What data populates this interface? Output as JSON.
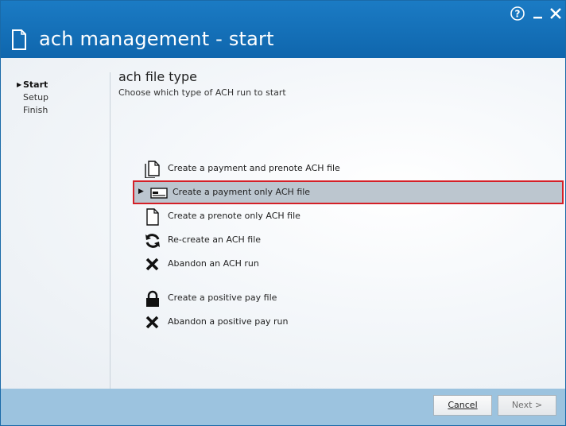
{
  "window": {
    "title": "ach management - start",
    "controls": {
      "help_icon": "help-circle-icon",
      "minimize_icon": "minimize-icon",
      "close_icon": "close-icon"
    }
  },
  "sidebar": {
    "items": [
      {
        "label": "Start",
        "active": true
      },
      {
        "label": "Setup",
        "active": false
      },
      {
        "label": "Finish",
        "active": false
      }
    ]
  },
  "main": {
    "heading": "ach file type",
    "subheading": "Choose which type of ACH run to start",
    "options": [
      {
        "label": "Create a payment and prenote ACH file",
        "icon": "documents-icon",
        "selected": false
      },
      {
        "label": "Create a payment only ACH file",
        "icon": "check-payment-icon",
        "selected": true
      },
      {
        "label": "Create a prenote only ACH file",
        "icon": "document-icon",
        "selected": false
      },
      {
        "label": "Re-create an ACH file",
        "icon": "refresh-icon",
        "selected": false
      },
      {
        "label": "Abandon an ACH run",
        "icon": "x-icon",
        "selected": false
      },
      {
        "label": "Create a positive pay file",
        "icon": "lock-icon",
        "selected": false
      },
      {
        "label": "Abandon a positive pay run",
        "icon": "x-icon",
        "selected": false
      }
    ]
  },
  "footer": {
    "cancel_label": "Cancel",
    "next_label": "Next >"
  },
  "colors": {
    "titlebar": "#1570b8",
    "footer": "#9cc3df",
    "selection_border": "#d42027",
    "selection_fill": "#bcc6cf"
  }
}
